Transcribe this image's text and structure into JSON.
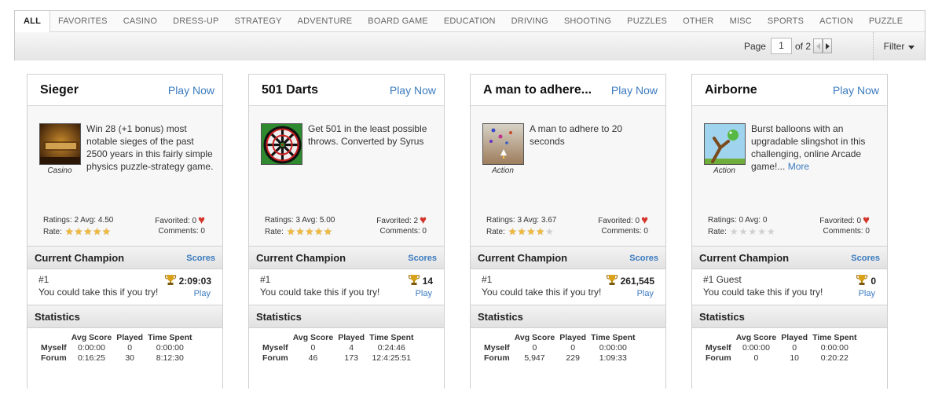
{
  "tabs": [
    "ALL",
    "FAVORITES",
    "CASINO",
    "DRESS-UP",
    "STRATEGY",
    "ADVENTURE",
    "BOARD GAME",
    "EDUCATION",
    "DRIVING",
    "SHOOTING",
    "PUZZLES",
    "OTHER",
    "MISC",
    "SPORTS",
    "ACTION",
    "PUZZLE"
  ],
  "pager": {
    "page_label": "Page",
    "current_page": "1",
    "of_label": "of 2",
    "filter_label": "Filter"
  },
  "labels": {
    "current_champion": "Current Champion",
    "scores": "Scores",
    "statistics": "Statistics",
    "avg_score": "Avg Score",
    "played": "Played",
    "time_spent": "Time Spent",
    "myself": "Myself",
    "forum": "Forum",
    "play": "Play",
    "rate": "Rate:"
  },
  "colors": {
    "link": "#3b7bbf",
    "star_on": "#f0b93a",
    "star_off": "#cfcfcf",
    "heart": "#d3352b",
    "trophy": "#d9a21a"
  },
  "games": [
    {
      "title": "Sieger",
      "play_now": "Play Now",
      "category": "Casino",
      "thumb_icon": "sieger-thumbnail",
      "description": "Win 28 (+1 bonus) most notable sieges of the past 2500 years in this fairly simple physics puzzle-strategy game.",
      "more": "",
      "ratings_text": "Ratings: 2 Avg: 4.50",
      "stars": 5,
      "favorited_text": "Favorited: 0",
      "comments_text": "Comments: 0",
      "champion_rank": "#1",
      "champion_score": "2:09:03",
      "champion_msg": "You could take this if you try!",
      "stats": {
        "myself": [
          "0:00:00",
          "0",
          "0:00:00"
        ],
        "forum": [
          "0:16:25",
          "30",
          "8:12:30"
        ]
      }
    },
    {
      "title": "501 Darts",
      "play_now": "Play Now",
      "category": "",
      "thumb_icon": "dartboard-thumbnail",
      "description": "Get 501 in the least possible throws. Converted by Syrus",
      "more": "",
      "ratings_text": "Ratings: 3 Avg: 5.00",
      "stars": 5,
      "favorited_text": "Favorited: 2",
      "comments_text": "Comments: 0",
      "champion_rank": "#1",
      "champion_score": "14",
      "champion_msg": "You could take this if you try!",
      "stats": {
        "myself": [
          "0",
          "4",
          "0:24:46"
        ],
        "forum": [
          "46",
          "173",
          "12:4:25:51"
        ]
      }
    },
    {
      "title": "A man to adhere...",
      "play_now": "Play Now",
      "category": "Action",
      "thumb_icon": "space-shooter-thumbnail",
      "description": "A man to adhere to 20 seconds",
      "more": "",
      "ratings_text": "Ratings: 3 Avg: 3.67",
      "stars": 4,
      "favorited_text": "Favorited: 0",
      "comments_text": "Comments: 0",
      "champion_rank": "#1",
      "champion_score": "261,545",
      "champion_msg": "You could take this if you try!",
      "stats": {
        "myself": [
          "0",
          "0",
          "0:00:00"
        ],
        "forum": [
          "5,947",
          "229",
          "1:09:33"
        ]
      }
    },
    {
      "title": "Airborne",
      "play_now": "Play Now",
      "category": "Action",
      "thumb_icon": "slingshot-thumbnail",
      "description": "Burst balloons with an upgradable slingshot in this challenging, online Arcade game!...",
      "more": "More",
      "ratings_text": "Ratings: 0 Avg: 0",
      "stars": 0,
      "favorited_text": "Favorited: 0",
      "comments_text": "Comments: 0",
      "champion_rank": "#1 Guest",
      "champion_score": "0",
      "champion_msg": "You could take this if you try!",
      "stats": {
        "myself": [
          "0:00:00",
          "0",
          "0:00:00"
        ],
        "forum": [
          "0",
          "10",
          "0:20:22"
        ]
      }
    }
  ]
}
